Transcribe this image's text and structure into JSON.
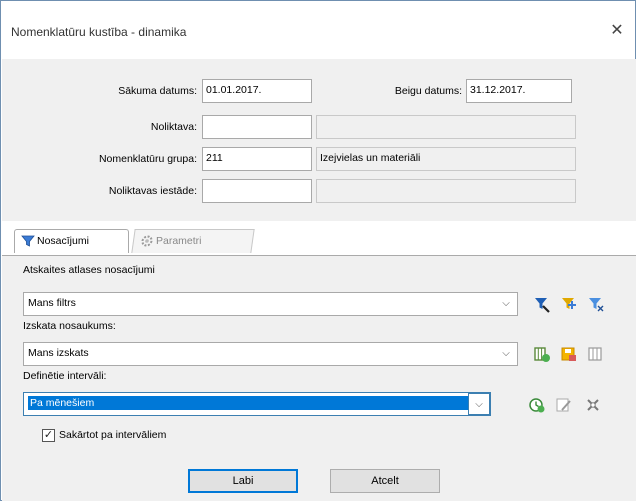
{
  "window": {
    "title": "Nomenklatūru kustība - dinamika",
    "close_glyph": "✕"
  },
  "filters": {
    "start_date_label": "Sākuma datums:",
    "start_date_value": "01.01.2017.",
    "end_date_label": "Beigu datums:",
    "end_date_value": "31.12.2017.",
    "warehouse_label": "Noliktava:",
    "warehouse_value": "",
    "warehouse_name": "",
    "group_label": "Nomenklatūru grupa:",
    "group_value": "211",
    "group_name": "Izejvielas un materiāli",
    "warehouse_site_label": "Noliktavas iestāde:",
    "warehouse_site_value": "",
    "warehouse_site_name": ""
  },
  "tabs": [
    {
      "label": "Nosacījumi",
      "icon": "filter-icon",
      "active": true
    },
    {
      "label": "Parametri",
      "icon": "gear-icon",
      "active": false
    }
  ],
  "conditions": {
    "report_filter_label": "Atskaites atlases nosacījumi",
    "report_filter_value": "Mans filtrs",
    "view_name_label": "Izskata nosaukums:",
    "view_name_value": "Mans izskats",
    "intervals_label": "Definētie intervāli:",
    "intervals_value": "Pa mēnešiem",
    "sort_by_intervals_label": "Sakārtot pa intervāliem",
    "sort_by_intervals_checked": true,
    "check_glyph": "✓",
    "dropdown_glyph": "⌵"
  },
  "buttons": {
    "ok_label": "Labi",
    "cancel_label": "Atcelt"
  },
  "colors": {
    "selection": "#0078d7",
    "panel": "#f0f0f0",
    "window_border": "#6f8fb0"
  }
}
